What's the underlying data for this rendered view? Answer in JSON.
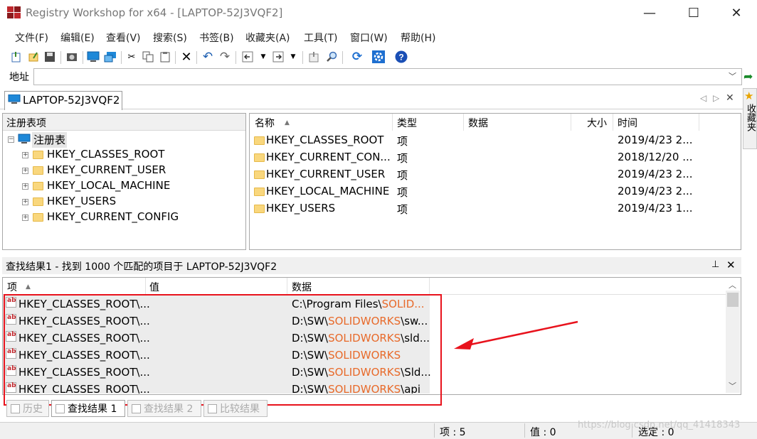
{
  "window": {
    "title": "Registry Workshop for x64 - [LAPTOP-52J3VQF2]",
    "minimize_glyph": "—",
    "maximize_glyph": "☐",
    "close_glyph": "✕"
  },
  "menu": [
    "文件(F)",
    "编辑(E)",
    "查看(V)",
    "搜索(S)",
    "书签(B)",
    "收藏夹(A)",
    "工具(T)",
    "窗口(W)",
    "帮助(H)"
  ],
  "toolbar": {
    "icons": [
      "import-icon",
      "export-icon",
      "save-icon",
      "snapshot-icon",
      "computer-icon",
      "network-icon",
      "cut-icon",
      "copy-icon",
      "paste-icon",
      "delete-icon",
      "undo-icon",
      "redo-icon",
      "back-icon",
      "back-dropdown-icon",
      "forward-icon",
      "forward-dropdown-icon",
      "up-icon",
      "find-icon",
      "refresh-icon",
      "settings-icon",
      "help-icon"
    ]
  },
  "address": {
    "label": "地址",
    "value": ""
  },
  "doc_tab": {
    "label": "LAPTOP-52J3VQF2"
  },
  "favorites": {
    "label": "收藏夹"
  },
  "tree": {
    "header": "注册表项",
    "root": "注册表",
    "items": [
      "HKEY_CLASSES_ROOT",
      "HKEY_CURRENT_USER",
      "HKEY_LOCAL_MACHINE",
      "HKEY_USERS",
      "HKEY_CURRENT_CONFIG"
    ]
  },
  "list": {
    "columns": {
      "name": "名称",
      "type": "类型",
      "data": "数据",
      "size": "大小",
      "time": "时间"
    },
    "rows": [
      {
        "name": "HKEY_CLASSES_ROOT",
        "type": "项",
        "time": "2019/4/23 2..."
      },
      {
        "name": "HKEY_CURRENT_CON...",
        "type": "项",
        "time": "2018/12/20 ..."
      },
      {
        "name": "HKEY_CURRENT_USER",
        "type": "项",
        "time": "2019/4/23 2..."
      },
      {
        "name": "HKEY_LOCAL_MACHINE",
        "type": "项",
        "time": "2019/4/23 2..."
      },
      {
        "name": "HKEY_USERS",
        "type": "项",
        "time": "2019/4/23 1..."
      }
    ]
  },
  "results": {
    "title": "查找结果1 - 找到 1000 个匹配的项目于 LAPTOP-52J3VQF2",
    "columns": {
      "item": "项",
      "value": "值",
      "data": "数据"
    },
    "rows": [
      {
        "item": "HKEY_CLASSES_ROOT\\...",
        "data_pre": "C:\\Program Files\\",
        "data_hl": "SOLID...",
        "data_post": ""
      },
      {
        "item": "HKEY_CLASSES_ROOT\\...",
        "data_pre": "D:\\SW\\",
        "data_hl": "SOLIDWORKS",
        "data_post": "\\sw..."
      },
      {
        "item": "HKEY_CLASSES_ROOT\\...",
        "data_pre": "D:\\SW\\",
        "data_hl": "SOLIDWORKS",
        "data_post": "\\sld..."
      },
      {
        "item": "HKEY_CLASSES_ROOT\\...",
        "data_pre": "D:\\SW\\",
        "data_hl": "SOLIDWORKS",
        "data_post": ""
      },
      {
        "item": "HKEY_CLASSES_ROOT\\...",
        "data_pre": "D:\\SW\\",
        "data_hl": "SOLIDWORKS",
        "data_post": "\\Sld..."
      },
      {
        "item": "HKEY_CLASSES_ROOT\\...",
        "data_pre": "D:\\SW\\",
        "data_hl": "SOLIDWORKS",
        "data_post": "\\api"
      }
    ],
    "pin_glyph": "⊥",
    "close_glyph": "✕"
  },
  "bottom_tabs": [
    {
      "label": "历史",
      "active": false
    },
    {
      "label": "查找结果 1",
      "active": true
    },
    {
      "label": "查找结果 2",
      "active": false
    },
    {
      "label": "比较结果",
      "active": false
    }
  ],
  "status": {
    "items": "项 : 5",
    "values": "值 : 0",
    "selected": "选定 : 0",
    "watermark": "https://blog.csdn.net/qq_41418343"
  },
  "colors": {
    "highlight_box": "#e8121c",
    "match_text": "#e86a2a",
    "folder": "#f9d77d"
  }
}
